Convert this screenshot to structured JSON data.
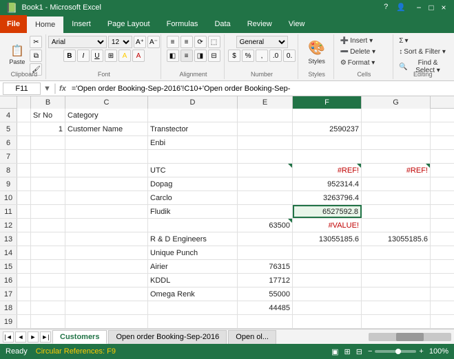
{
  "titleBar": {
    "title": "Book1 - Microsoft Excel",
    "minimizeLabel": "−",
    "restoreLabel": "□",
    "closeLabel": "×",
    "helpIcon": "?",
    "userIcon": "👤"
  },
  "ribbon": {
    "fileLabel": "File",
    "tabs": [
      "Home",
      "Insert",
      "Page Layout",
      "Formulas",
      "Data",
      "Review",
      "View"
    ],
    "activeTab": "Home",
    "groups": [
      {
        "label": "Clipboard",
        "buttons": [
          {
            "icon": "📋",
            "label": "Paste"
          }
        ]
      },
      {
        "label": "Font",
        "fontName": "Arial",
        "fontSize": "12",
        "boldLabel": "B",
        "italicLabel": "I",
        "underlineLabel": "U"
      },
      {
        "label": "Alignment"
      },
      {
        "label": "Number",
        "formatLabel": "General"
      },
      {
        "label": "Styles",
        "stylesLabel": "Styles"
      },
      {
        "label": "Cells",
        "insertLabel": "Insert",
        "deleteLabel": "Delete",
        "formatLabel": "Format"
      },
      {
        "label": "Editing",
        "sumLabel": "Σ",
        "sortLabel": "Sort &\nFilter",
        "findLabel": "Find &\nSelect"
      }
    ]
  },
  "formulaBar": {
    "cellRef": "F11",
    "formula": "='Open order Booking-Sep-2016'!C10+'Open order Booking-Sep-",
    "fxLabel": "fx"
  },
  "columns": {
    "headers": [
      "",
      "B",
      "C",
      "D",
      "E",
      "F",
      "G"
    ],
    "selectedCol": "F"
  },
  "rows": [
    {
      "num": 4,
      "cells": [
        "",
        "Sr No",
        "Category",
        "",
        "",
        "",
        ""
      ]
    },
    {
      "num": 5,
      "cells": [
        "",
        "1",
        "Customer Name",
        "Transtector",
        "",
        "2590237",
        ""
      ]
    },
    {
      "num": 6,
      "cells": [
        "",
        "",
        "",
        "Enbi",
        "",
        "",
        ""
      ]
    },
    {
      "num": 7,
      "cells": [
        "",
        "",
        "",
        "",
        "",
        "",
        ""
      ]
    },
    {
      "num": 8,
      "cells": [
        "",
        "",
        "",
        "UTC",
        "",
        "#REF!",
        "#REF!"
      ],
      "hasError": true
    },
    {
      "num": 9,
      "cells": [
        "",
        "",
        "",
        "Dopag",
        "",
        "952314.4",
        ""
      ]
    },
    {
      "num": 10,
      "cells": [
        "",
        "",
        "",
        "Carclo",
        "",
        "3263796.4",
        ""
      ]
    },
    {
      "num": 11,
      "cells": [
        "",
        "",
        "",
        "Fludik",
        "",
        "6527592.8",
        ""
      ],
      "selectedRow": false,
      "selectedCell": "F"
    },
    {
      "num": 12,
      "cells": [
        "",
        "",
        "",
        "",
        "63500",
        "#VALUE!",
        ""
      ],
      "hasError": true
    },
    {
      "num": 13,
      "cells": [
        "",
        "",
        "",
        "R & D Engineers",
        "",
        "13055185.6",
        "13055185.6"
      ]
    },
    {
      "num": 14,
      "cells": [
        "",
        "",
        "",
        "Unique Punch",
        "",
        "",
        ""
      ]
    },
    {
      "num": 15,
      "cells": [
        "",
        "",
        "",
        "Airier",
        "76315",
        "",
        ""
      ]
    },
    {
      "num": 16,
      "cells": [
        "",
        "",
        "",
        "KDDL",
        "17712",
        "",
        ""
      ]
    },
    {
      "num": 17,
      "cells": [
        "",
        "",
        "",
        "Omega Renk",
        "55000",
        "",
        ""
      ]
    },
    {
      "num": 18,
      "cells": [
        "",
        "",
        "",
        "",
        "44485",
        "",
        ""
      ]
    },
    {
      "num": 19,
      "cells": [
        "",
        "",
        "",
        "",
        "",
        "",
        ""
      ]
    }
  ],
  "sheetTabs": {
    "tabs": [
      "Customers",
      "Open order Booking-Sep-2016",
      "Open ol..."
    ],
    "activeTab": "Customers"
  },
  "statusBar": {
    "readyLabel": "Ready",
    "warningLabel": "Circular References: F9",
    "zoomLabel": "100%",
    "zoomValue": 100
  }
}
